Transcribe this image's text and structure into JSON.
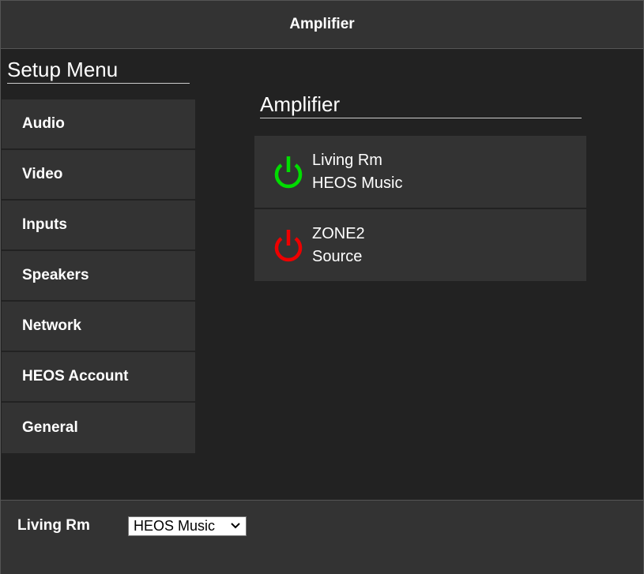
{
  "header": {
    "title": "Amplifier"
  },
  "sidebar": {
    "heading": "Setup Menu",
    "items": [
      {
        "label": "Audio"
      },
      {
        "label": "Video"
      },
      {
        "label": "Inputs"
      },
      {
        "label": "Speakers"
      },
      {
        "label": "Network"
      },
      {
        "label": "HEOS Account"
      },
      {
        "label": "General"
      }
    ]
  },
  "main": {
    "heading": "Amplifier",
    "zones": [
      {
        "name": "Living Rm",
        "source": "HEOS Music",
        "power_icon": "power-icon",
        "power_color": "#00dd00",
        "power_state": "on"
      },
      {
        "name": "ZONE2",
        "source": "Source",
        "power_icon": "power-icon",
        "power_color": "#ee0000",
        "power_state": "off"
      }
    ]
  },
  "footer": {
    "zone_label": "Living Rm",
    "source_select": {
      "selected": "HEOS Music",
      "icon": "chevron-down-icon"
    }
  }
}
